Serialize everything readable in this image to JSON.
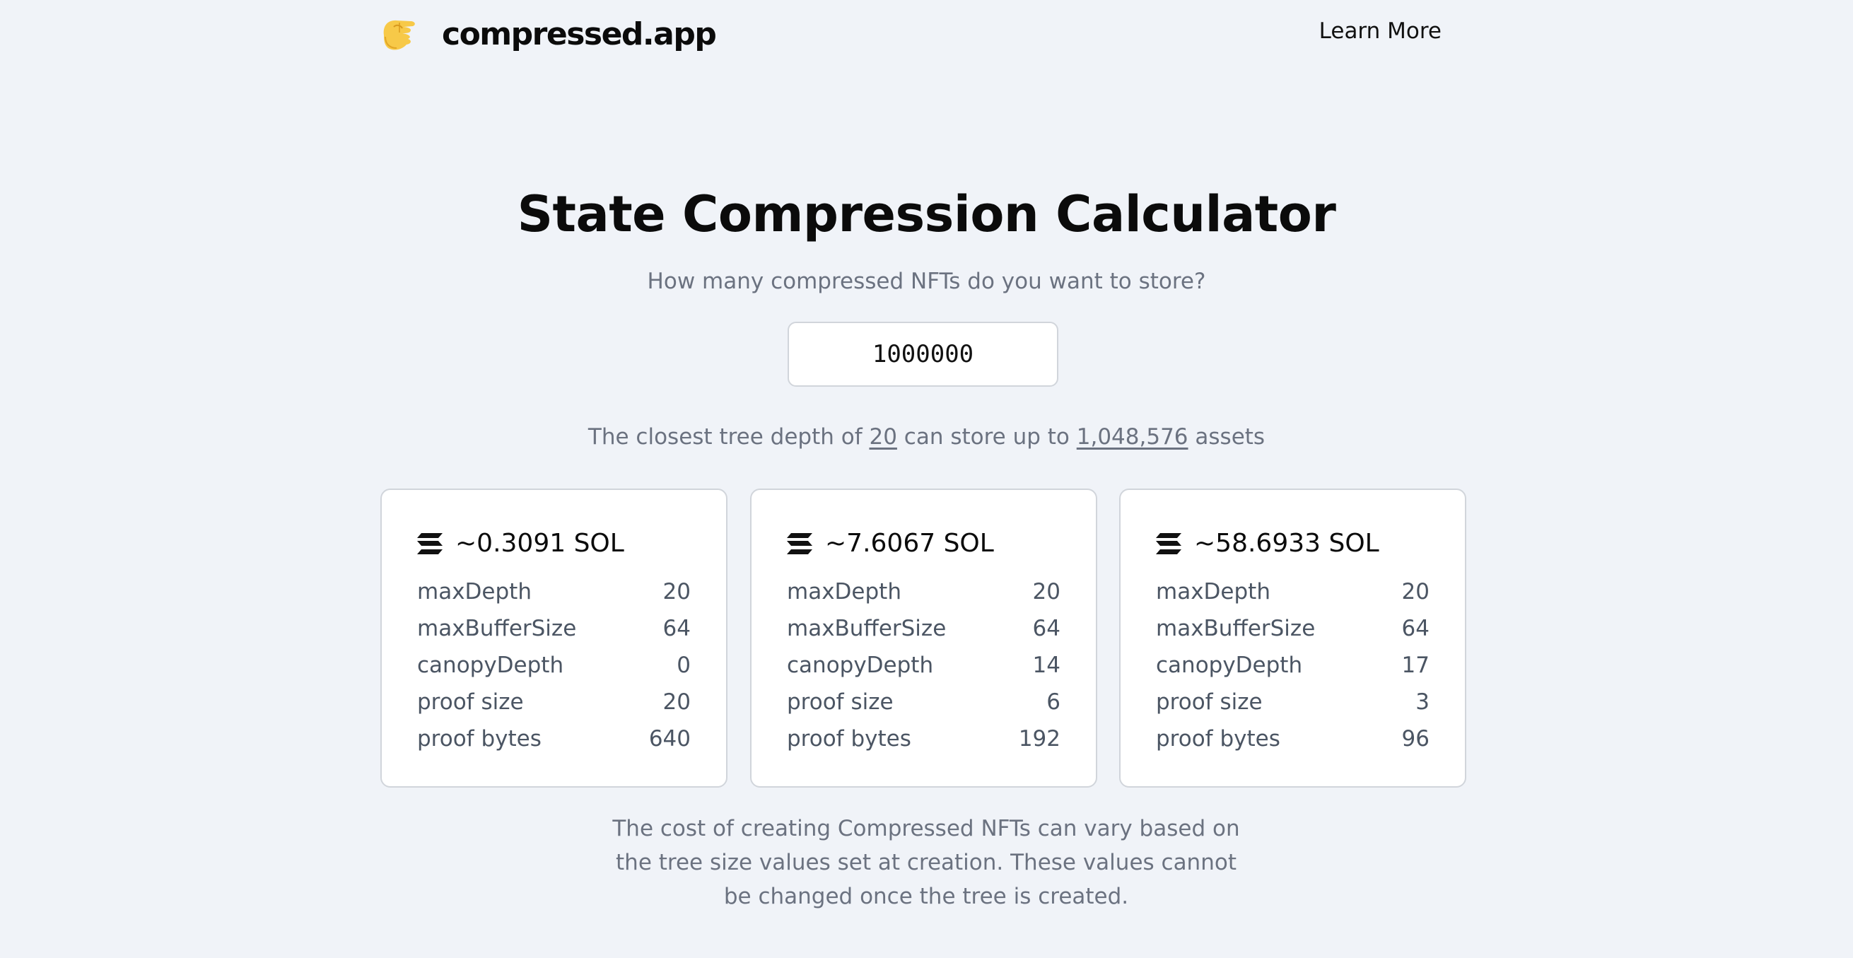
{
  "header": {
    "logo_icon": "pinching-hand-icon",
    "logo_text": "compressed.app",
    "learn_more": "Learn More"
  },
  "hero": {
    "title": "State Compression Calculator",
    "subtitle": "How many compressed NFTs do you want to store?",
    "input_value": "1000000"
  },
  "depth_info": {
    "prefix": "The closest tree depth of",
    "depth": "20",
    "middle": "can store up to",
    "capacity": "1,048,576",
    "suffix": "assets"
  },
  "cards": [
    {
      "icon": "solana-icon",
      "cost": "~0.3091 SOL",
      "rows": [
        {
          "label": "maxDepth",
          "value": "20"
        },
        {
          "label": "maxBufferSize",
          "value": "64"
        },
        {
          "label": "canopyDepth",
          "value": "0"
        },
        {
          "label": "proof size",
          "value": "20"
        },
        {
          "label": "proof bytes",
          "value": "640"
        }
      ]
    },
    {
      "icon": "solana-icon",
      "cost": "~7.6067 SOL",
      "rows": [
        {
          "label": "maxDepth",
          "value": "20"
        },
        {
          "label": "maxBufferSize",
          "value": "64"
        },
        {
          "label": "canopyDepth",
          "value": "14"
        },
        {
          "label": "proof size",
          "value": "6"
        },
        {
          "label": "proof bytes",
          "value": "192"
        }
      ]
    },
    {
      "icon": "solana-icon",
      "cost": "~58.6933 SOL",
      "rows": [
        {
          "label": "maxDepth",
          "value": "20"
        },
        {
          "label": "maxBufferSize",
          "value": "64"
        },
        {
          "label": "canopyDepth",
          "value": "17"
        },
        {
          "label": "proof size",
          "value": "3"
        },
        {
          "label": "proof bytes",
          "value": "96"
        }
      ]
    }
  ],
  "footnote": "The cost of creating Compressed NFTs can vary based on the tree size values set at creation. These values cannot be changed once the tree is created.",
  "colors": {
    "background": "#f0f3f8",
    "text_muted": "#6b7280",
    "card_border": "#d1d5db",
    "logo_yellow": "#f7c948"
  }
}
